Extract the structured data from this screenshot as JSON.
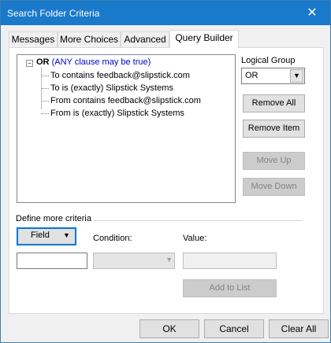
{
  "window": {
    "title": "Search Folder Criteria",
    "close_glyph": "✕"
  },
  "tabs": [
    {
      "label": "Messages"
    },
    {
      "label": "More Choices"
    },
    {
      "label": "Advanced"
    },
    {
      "label": "Query Builder"
    }
  ],
  "query_tree": {
    "root_toggle": "−",
    "root_op": "OR",
    "root_desc": "(ANY clause may be true)",
    "items": [
      {
        "label": "To contains feedback@slipstick.com"
      },
      {
        "label": "To is (exactly) Slipstick Systems"
      },
      {
        "label": "From contains feedback@slipstick.com"
      },
      {
        "label": "From is (exactly) Slipstick Systems"
      }
    ]
  },
  "logical_group": {
    "label": "Logical Group",
    "value": "OR"
  },
  "buttons": {
    "remove_all": "Remove All",
    "remove_item": "Remove Item",
    "move_up": "Move Up",
    "move_down": "Move Down",
    "add_to_list": "Add to List"
  },
  "define": {
    "label": "Define more criteria",
    "field_button": "Field",
    "condition_label": "Condition:",
    "value_label": "Value:"
  },
  "footer": {
    "ok": "OK",
    "cancel": "Cancel",
    "clear_all": "Clear All"
  },
  "colors": {
    "titlebar": "#1979ca",
    "any_clause": "#0000cc",
    "focus": "#0078d7"
  }
}
